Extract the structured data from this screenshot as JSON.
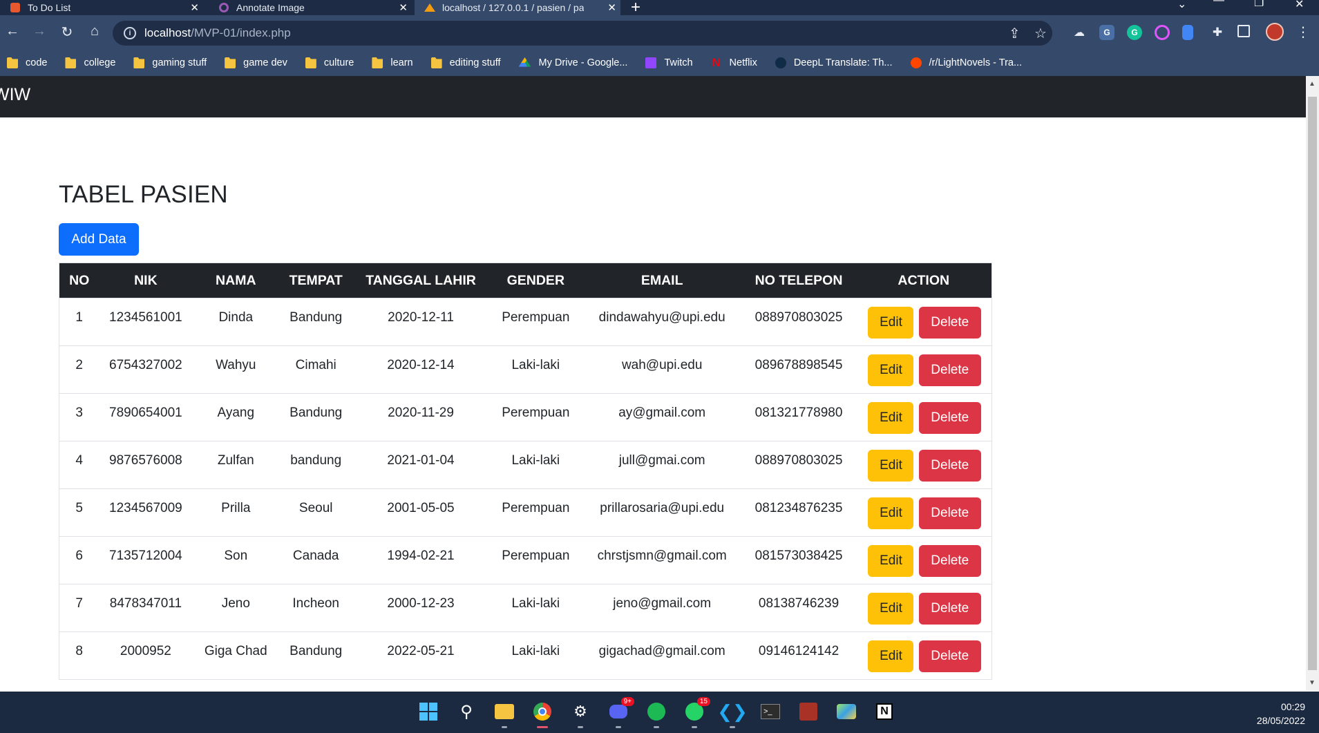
{
  "browser": {
    "tabs": [
      {
        "title": "To Do List",
        "active": false
      },
      {
        "title": "Annotate Image",
        "active": false
      },
      {
        "title": "localhost / 127.0.0.1 / pasien / pa",
        "active": true
      }
    ],
    "url_host": "localhost",
    "url_path": "/MVP-01/index.php",
    "bookmarks": [
      {
        "label": "code",
        "icon": "folder-icon"
      },
      {
        "label": "college",
        "icon": "folder-icon"
      },
      {
        "label": "gaming stuff",
        "icon": "folder-icon"
      },
      {
        "label": "game dev",
        "icon": "folder-icon"
      },
      {
        "label": "culture",
        "icon": "folder-icon"
      },
      {
        "label": "learn",
        "icon": "folder-icon"
      },
      {
        "label": "editing stuff",
        "icon": "folder-icon"
      },
      {
        "label": "My Drive - Google...",
        "icon": "google-drive-icon"
      },
      {
        "label": "Twitch",
        "icon": "twitch-icon"
      },
      {
        "label": "Netflix",
        "icon": "netflix-icon"
      },
      {
        "label": "DeepL Translate: Th...",
        "icon": "deepl-icon"
      },
      {
        "label": "/r/LightNovels - Tra...",
        "icon": "reddit-icon"
      }
    ]
  },
  "app": {
    "brand": "WIW",
    "page_title": "TABEL PASIEN",
    "add_button": "Add Data",
    "columns": [
      "NO",
      "NIK",
      "NAMA",
      "TEMPAT",
      "TANGGAL LAHIR",
      "GENDER",
      "EMAIL",
      "NO TELEPON",
      "ACTION"
    ],
    "edit_label": "Edit",
    "delete_label": "Delete",
    "rows": [
      {
        "no": "1",
        "nik": "1234561001",
        "nama": "Dinda",
        "tempat": "Bandung",
        "tanggal_lahir": "2020-12-11",
        "gender": "Perempuan",
        "email": "dindawahyu@upi.edu",
        "telepon": "088970803025"
      },
      {
        "no": "2",
        "nik": "6754327002",
        "nama": "Wahyu",
        "tempat": "Cimahi",
        "tanggal_lahir": "2020-12-14",
        "gender": "Laki-laki",
        "email": "wah@upi.edu",
        "telepon": "089678898545"
      },
      {
        "no": "3",
        "nik": "7890654001",
        "nama": "Ayang",
        "tempat": "Bandung",
        "tanggal_lahir": "2020-11-29",
        "gender": "Perempuan",
        "email": "ay@gmail.com",
        "telepon": "081321778980"
      },
      {
        "no": "4",
        "nik": "9876576008",
        "nama": "Zulfan",
        "tempat": "bandung",
        "tanggal_lahir": "2021-01-04",
        "gender": "Laki-laki",
        "email": "jull@gmai.com",
        "telepon": "088970803025"
      },
      {
        "no": "5",
        "nik": "1234567009",
        "nama": "Prilla",
        "tempat": "Seoul",
        "tanggal_lahir": "2001-05-05",
        "gender": "Perempuan",
        "email": "prillarosaria@upi.edu",
        "telepon": "081234876235"
      },
      {
        "no": "6",
        "nik": "7135712004",
        "nama": "Son",
        "tempat": "Canada",
        "tanggal_lahir": "1994-02-21",
        "gender": "Perempuan",
        "email": "chrstjsmn@gmail.com",
        "telepon": "081573038425"
      },
      {
        "no": "7",
        "nik": "8478347011",
        "nama": "Jeno",
        "tempat": "Incheon",
        "tanggal_lahir": "2000-12-23",
        "gender": "Laki-laki",
        "email": "jeno@gmail.com",
        "telepon": "08138746239"
      },
      {
        "no": "8",
        "nik": "2000952",
        "nama": "Giga Chad",
        "tempat": "Bandung",
        "tanggal_lahir": "2022-05-21",
        "gender": "Laki-laki",
        "email": "gigachad@gmail.com",
        "telepon": "09146124142"
      }
    ]
  },
  "taskbar": {
    "time": "00:29",
    "date": "28/05/2022",
    "discord_badge": "9+",
    "whatsapp_badge": "15"
  },
  "colors": {
    "primary": "#0d6efd",
    "warning": "#ffc107",
    "danger": "#dc3545",
    "dark": "#212529",
    "chrome": "#35496b"
  }
}
